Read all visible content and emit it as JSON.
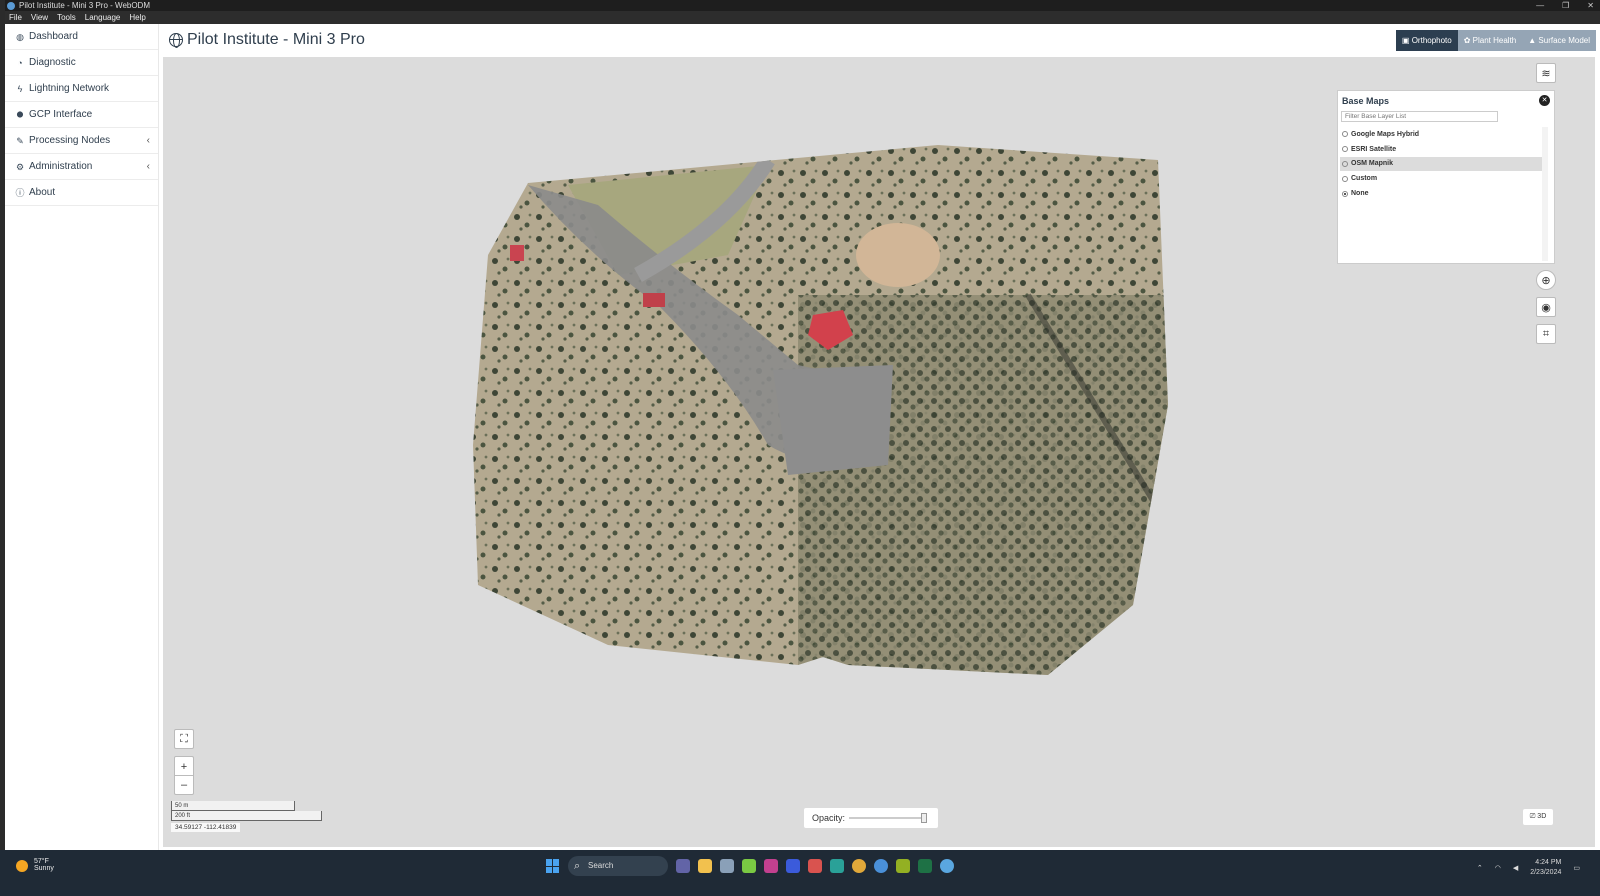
{
  "window": {
    "title": "Pilot Institute - Mini 3 Pro - WebODM",
    "controls": [
      "—",
      "❐",
      "✕"
    ]
  },
  "menubar": [
    "File",
    "View",
    "Tools",
    "Language",
    "Help"
  ],
  "sidebar": {
    "items": [
      {
        "label": "Dashboard",
        "icon": "dashboard-icon",
        "glyph": "◍"
      },
      {
        "label": "Diagnostic",
        "icon": "pie-chart-icon",
        "glyph": "◔"
      },
      {
        "label": "Lightning Network",
        "icon": "bolt-icon",
        "glyph": "ϟ"
      },
      {
        "label": "GCP Interface",
        "icon": "map-marker-icon",
        "glyph": "⬤"
      },
      {
        "label": "Processing Nodes",
        "icon": "wrench-icon",
        "glyph": "✎",
        "chevron": "‹"
      },
      {
        "label": "Administration",
        "icon": "cogs-icon",
        "glyph": "⚙",
        "chevron": "‹"
      },
      {
        "label": "About",
        "icon": "info-icon",
        "glyph": "ⓘ"
      }
    ]
  },
  "header": {
    "title": "Pilot Institute - Mini 3 Pro",
    "tabs": [
      {
        "label": "Orthophoto",
        "active": true
      },
      {
        "label": "Plant Health",
        "active": false
      },
      {
        "label": "Surface Model",
        "active": false
      }
    ]
  },
  "map": {
    "base_maps": {
      "title": "Base Maps",
      "filter_placeholder": "Filter Base Layer List",
      "options": [
        {
          "label": "Google Maps Hybrid",
          "selected": false
        },
        {
          "label": "ESRI Satellite",
          "selected": false
        },
        {
          "label": "OSM Mapnik",
          "selected": false
        },
        {
          "label": "Custom",
          "selected": false
        },
        {
          "label": "None",
          "selected": true
        }
      ]
    },
    "scale": {
      "metric": "50 m",
      "imperial": "200 ft"
    },
    "coords": "34.59127  -112.41839",
    "opacity_label": "Opacity:",
    "opacity_value": 1.0,
    "zoom_in": "+",
    "zoom_out": "–",
    "view3d_label": "3D"
  },
  "taskbar": {
    "weather": {
      "temp": "57°F",
      "condition": "Sunny"
    },
    "search_placeholder": "Search",
    "time": "4:24 PM",
    "date": "2/23/2024"
  },
  "colors": {
    "sidebar_text": "#2f3e4d",
    "active_tab": "#2c3e50",
    "inactive_tab": "#95a5b5",
    "map_bg": "#dcdcdc",
    "taskbar": "#1f2a36"
  }
}
